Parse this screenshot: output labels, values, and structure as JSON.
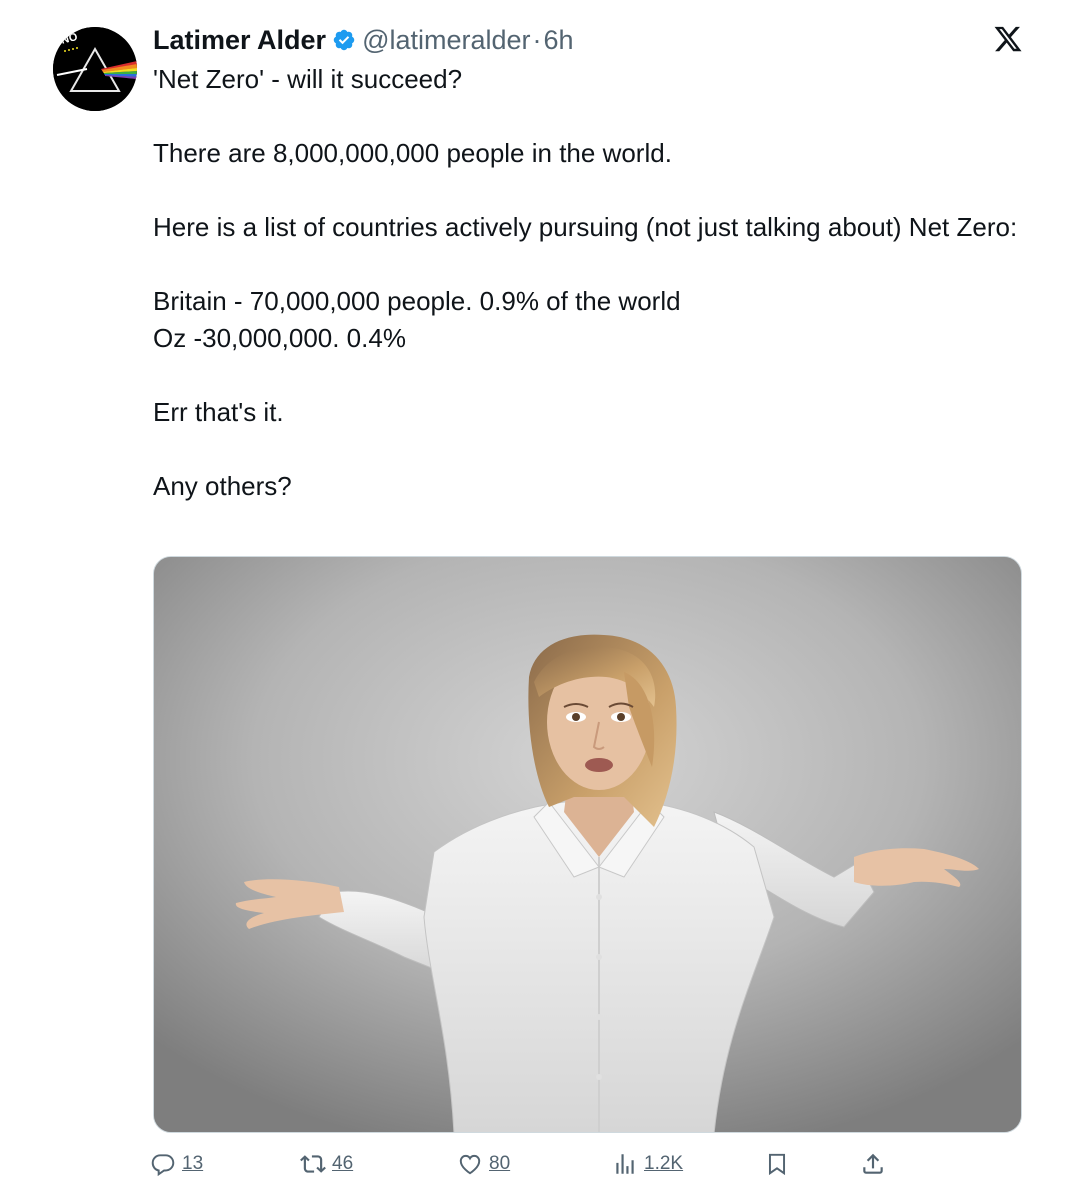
{
  "author": {
    "display_name": "Latimer Alder",
    "handle": "@latimeralder",
    "separator": "·",
    "time": "6h",
    "avatar_badge": "NO"
  },
  "tweet": {
    "line1": "'Net Zero' - will it succeed?",
    "line2": "There are 8,000,000,000 people in the world.",
    "line3": "Here is a list of countries actively pursuing (not just talking about)  Net Zero:",
    "line4": "Britain - 70,000,000 people. 0.9% of the world",
    "line5": "Oz -30,000,000. 0.4%",
    "line6": "Err that's it.",
    "line7": "Any others?"
  },
  "actions": {
    "replies": "13",
    "reposts": "46",
    "likes": "80",
    "views": "1.2K"
  },
  "icons": {
    "verified": "verified-badge-icon",
    "platform": "x-logo-icon",
    "reply": "reply-icon",
    "repost": "repost-icon",
    "like": "heart-icon",
    "views": "views-icon",
    "bookmark": "bookmark-icon",
    "share": "share-icon"
  },
  "colors": {
    "text": "#0f1419",
    "secondary": "#536471",
    "verified": "#1d9bf0"
  }
}
